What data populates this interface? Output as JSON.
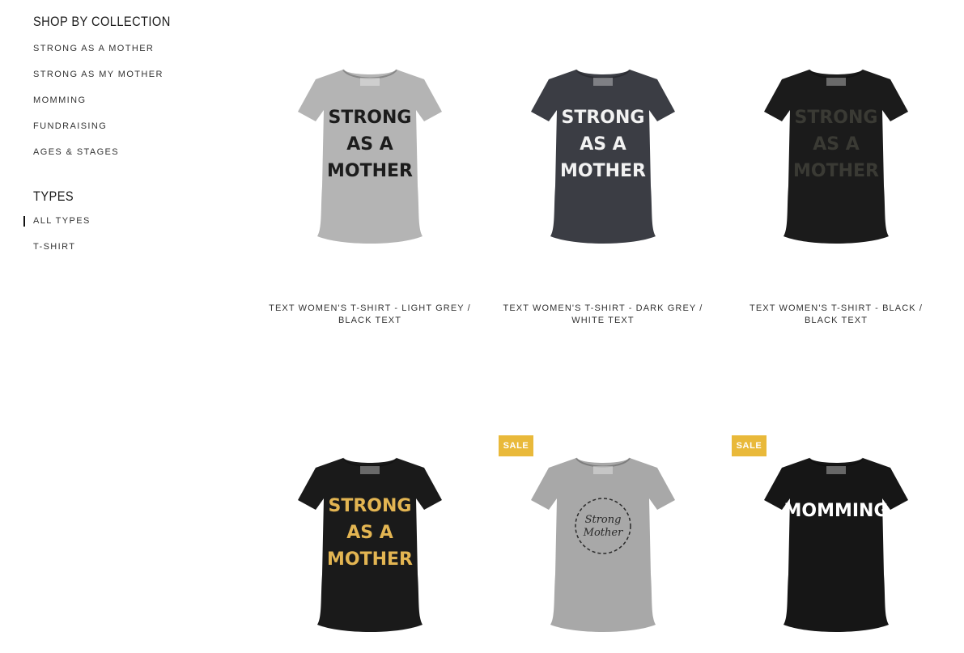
{
  "sidebar": {
    "collection_heading": "SHOP BY COLLECTION",
    "collections": [
      {
        "label": "STRONG AS A MOTHER"
      },
      {
        "label": "STRONG AS MY MOTHER"
      },
      {
        "label": "MOMMING"
      },
      {
        "label": "FUNDRAISING"
      },
      {
        "label": "AGES & STAGES"
      }
    ],
    "types_heading": "TYPES",
    "types": [
      {
        "label": "ALL TYPES",
        "active": true
      },
      {
        "label": "T-SHIRT",
        "active": false
      }
    ]
  },
  "products": [
    {
      "title_line1": "TEXT WOMEN'S T-SHIRT - LIGHT GREY /",
      "title_line2": "BLACK TEXT",
      "shirt_color": "#b4b4b4",
      "print_color": "#1c1c1c",
      "print_lines": [
        "STRONG",
        "AS A",
        "MOTHER"
      ]
    },
    {
      "title_line1": "TEXT WOMEN'S T-SHIRT - DARK GREY /",
      "title_line2": "WHITE TEXT",
      "shirt_color": "#3b3d44",
      "print_color": "#f2f2f2",
      "print_lines": [
        "STRONG",
        "AS A",
        "MOTHER"
      ]
    },
    {
      "title_line1": "TEXT WOMEN'S T-SHIRT - BLACK /",
      "title_line2": "BLACK TEXT",
      "shirt_color": "#1b1b1b",
      "print_color": "#3a3a34",
      "print_lines": [
        "STRONG",
        "AS A",
        "MOTHER"
      ]
    },
    {
      "shirt_color": "#1a1a1a",
      "print_color": "#e3b552",
      "print_lines": [
        "STRONG",
        "AS A",
        "MOTHER"
      ]
    },
    {
      "sale_label": "SALE",
      "shirt_color": "#a8a8a8",
      "print_color": "#2a2a2a",
      "script_lines": [
        "Strong",
        "Mother"
      ]
    },
    {
      "sale_label": "SALE",
      "shirt_color": "#161616",
      "print_color": "#ffffff",
      "print_lines": [
        "MOMMING"
      ]
    }
  ]
}
